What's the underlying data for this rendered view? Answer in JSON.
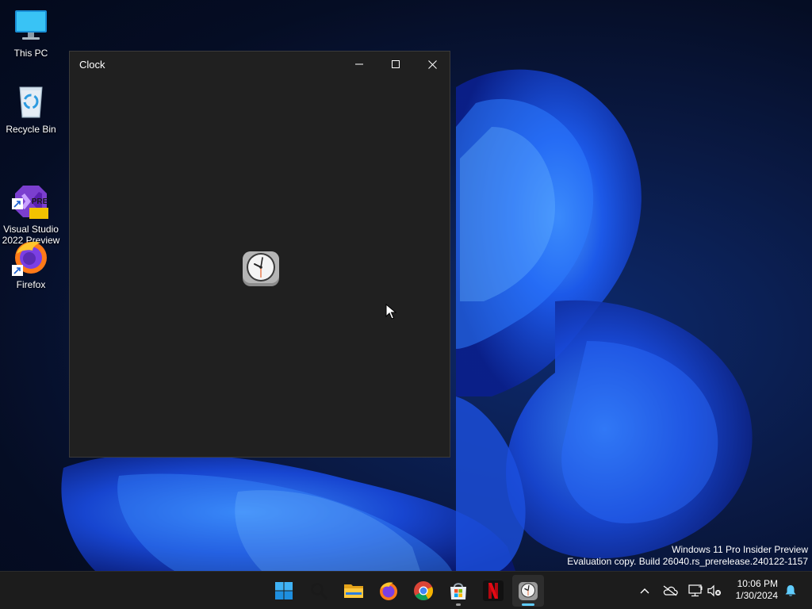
{
  "desktop": {
    "icons": [
      {
        "label": "This PC",
        "icon": "monitor-icon"
      },
      {
        "label": "Recycle Bin",
        "icon": "recycle-bin-icon"
      },
      {
        "label": "Visual Studio\n2022 Preview",
        "icon": "visual-studio-icon",
        "badge": "PRE"
      },
      {
        "label": "Firefox",
        "icon": "firefox-icon"
      }
    ],
    "watermark": {
      "line1": "Windows 11 Pro Insider Preview",
      "line2": "Evaluation copy. Build 26040.rs_prerelease.240122-1157"
    }
  },
  "window": {
    "title": "Clock",
    "controls": [
      "minimize",
      "maximize",
      "close"
    ],
    "content_icon": "clock-app-icon"
  },
  "taskbar": {
    "apps": [
      {
        "name": "Start",
        "icon": "windows-start-icon"
      },
      {
        "name": "Search",
        "icon": "search-icon"
      },
      {
        "name": "File Explorer",
        "icon": "folder-icon"
      },
      {
        "name": "Firefox",
        "icon": "firefox-icon"
      },
      {
        "name": "Chrome",
        "icon": "chrome-icon"
      },
      {
        "name": "Microsoft Store",
        "icon": "store-icon",
        "running": true
      },
      {
        "name": "Netflix",
        "icon": "netflix-icon"
      },
      {
        "name": "Clock",
        "icon": "clock-app-icon",
        "active": true
      }
    ],
    "tray": {
      "icons": [
        "chevron-up-icon",
        "onedrive-offline-icon",
        "network-icon",
        "volume-muted-icon"
      ],
      "time": "10:06 PM",
      "date": "1/30/2024",
      "notification_icon": "bell-icon"
    }
  },
  "colors": {
    "accent": "#60cdff",
    "window_bg": "#202020",
    "taskbar_bg": "#1c1c1c"
  }
}
